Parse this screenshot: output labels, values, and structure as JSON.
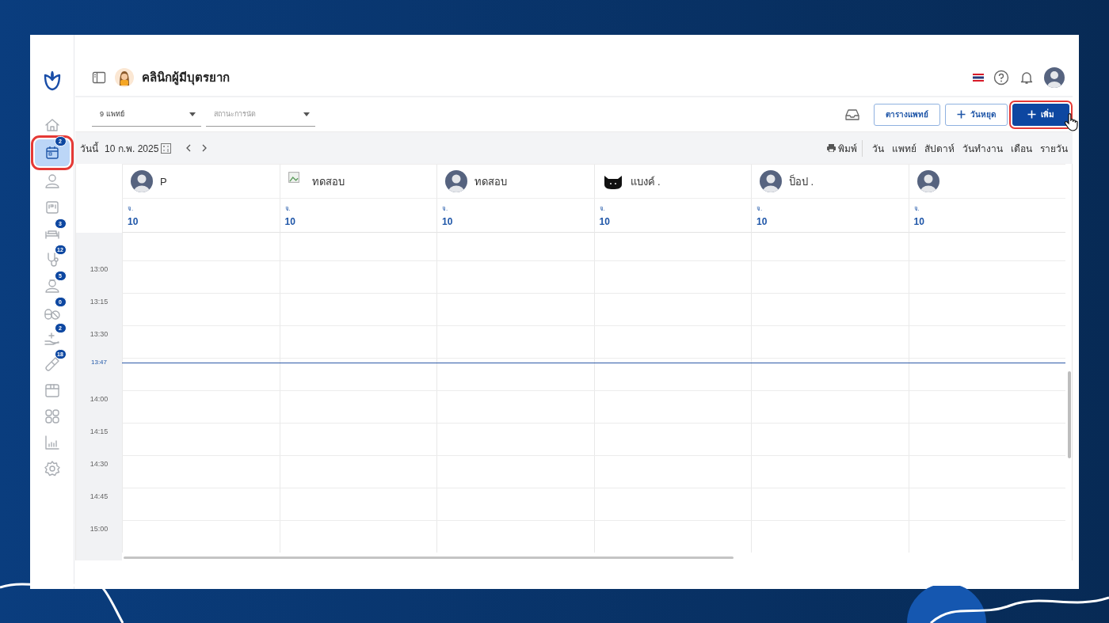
{
  "sidebar": {
    "items": [
      {
        "kind": "home",
        "selected": false
      },
      {
        "kind": "calendar",
        "selected": true,
        "badge": "2",
        "highlighted": true
      },
      {
        "kind": "person",
        "selected": false
      },
      {
        "kind": "id-card",
        "selected": false
      },
      {
        "kind": "bed",
        "selected": false,
        "badge": "3"
      },
      {
        "kind": "stethoscope",
        "selected": false,
        "badge": "12"
      },
      {
        "kind": "nurse",
        "selected": false,
        "badge": "5"
      },
      {
        "kind": "pills",
        "selected": false,
        "badge": "0"
      },
      {
        "kind": "hand",
        "selected": false,
        "badge": "2"
      },
      {
        "kind": "tube",
        "selected": false,
        "badge": "18"
      },
      {
        "kind": "box",
        "selected": false
      },
      {
        "kind": "apps",
        "selected": false
      },
      {
        "kind": "chart",
        "selected": false
      },
      {
        "kind": "settings",
        "selected": false
      }
    ]
  },
  "header": {
    "clinic_name": "คลินิกผู้มีบุตรยาก"
  },
  "filters": [
    {
      "value": "9 แพทย์"
    },
    {
      "placeholder": "สถานะการนัด"
    }
  ],
  "actions": [
    {
      "kind": "outline",
      "label": "ตารางแพทย์",
      "highlighted": false
    },
    {
      "kind": "outline-plus",
      "label": "วันหยุด",
      "highlighted": false
    },
    {
      "kind": "primary-plus",
      "label": "เพิ่ม",
      "highlighted": true
    }
  ],
  "date_bar": {
    "today_label": "วันนี้",
    "date": "10 ก.พ. 2025",
    "print": "พิมพ์",
    "views": [
      {
        "label": "วัน",
        "selected": false
      },
      {
        "label": "แพทย์",
        "selected": false
      },
      {
        "label": "สัปดาห์",
        "selected": false
      },
      {
        "label": "วันทำงาน",
        "selected": false
      },
      {
        "label": "เดือน",
        "selected": false
      },
      {
        "label": "รายวัน",
        "selected": false
      }
    ]
  },
  "columns": [
    {
      "kind": "silhouette",
      "name": "P",
      "weekday": "จ.",
      "day": "10"
    },
    {
      "kind": "broken-image",
      "name": "ทดสอบ",
      "weekday": "จ.",
      "day": "10"
    },
    {
      "kind": "silhouette",
      "name": "ทดสอบ",
      "weekday": "จ.",
      "day": "10"
    },
    {
      "kind": "cat",
      "name": "แบงค์ .",
      "weekday": "จ.",
      "day": "10"
    },
    {
      "kind": "silhouette",
      "name": "ป็อป .",
      "weekday": "จ.",
      "day": "10"
    },
    {
      "kind": "silhouette",
      "weekday": "จ.",
      "day": "10"
    }
  ],
  "slots": [
    {
      "kind": "slot",
      "time": "13:00"
    },
    {
      "kind": "slot",
      "time": "13:15"
    },
    {
      "kind": "slot",
      "time": "13:30"
    },
    {
      "kind": "now",
      "time": "13:47"
    },
    {
      "kind": "slot",
      "time": "14:00"
    },
    {
      "kind": "slot",
      "time": "14:15"
    },
    {
      "kind": "slot",
      "time": "14:30"
    },
    {
      "kind": "slot",
      "time": "14:45"
    },
    {
      "kind": "slot",
      "time": "15:00"
    }
  ]
}
